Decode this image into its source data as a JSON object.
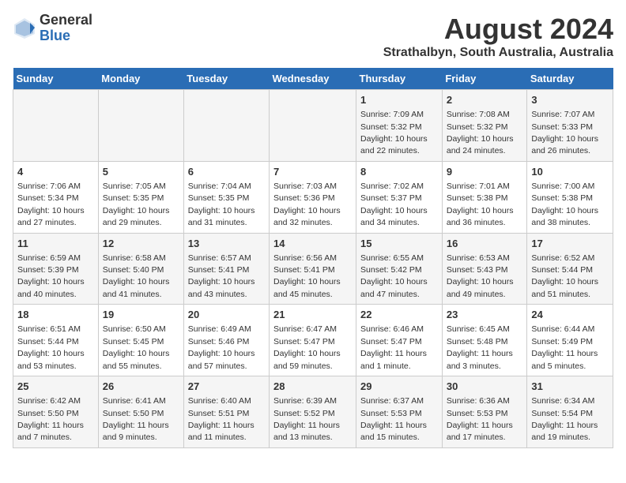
{
  "logo": {
    "general": "General",
    "blue": "Blue"
  },
  "title": {
    "month_year": "August 2024",
    "location": "Strathalbyn, South Australia, Australia"
  },
  "days_of_week": [
    "Sunday",
    "Monday",
    "Tuesday",
    "Wednesday",
    "Thursday",
    "Friday",
    "Saturday"
  ],
  "weeks": [
    [
      {
        "day": "",
        "info": ""
      },
      {
        "day": "",
        "info": ""
      },
      {
        "day": "",
        "info": ""
      },
      {
        "day": "",
        "info": ""
      },
      {
        "day": "1",
        "info": "Sunrise: 7:09 AM\nSunset: 5:32 PM\nDaylight: 10 hours\nand 22 minutes."
      },
      {
        "day": "2",
        "info": "Sunrise: 7:08 AM\nSunset: 5:32 PM\nDaylight: 10 hours\nand 24 minutes."
      },
      {
        "day": "3",
        "info": "Sunrise: 7:07 AM\nSunset: 5:33 PM\nDaylight: 10 hours\nand 26 minutes."
      }
    ],
    [
      {
        "day": "4",
        "info": "Sunrise: 7:06 AM\nSunset: 5:34 PM\nDaylight: 10 hours\nand 27 minutes."
      },
      {
        "day": "5",
        "info": "Sunrise: 7:05 AM\nSunset: 5:35 PM\nDaylight: 10 hours\nand 29 minutes."
      },
      {
        "day": "6",
        "info": "Sunrise: 7:04 AM\nSunset: 5:35 PM\nDaylight: 10 hours\nand 31 minutes."
      },
      {
        "day": "7",
        "info": "Sunrise: 7:03 AM\nSunset: 5:36 PM\nDaylight: 10 hours\nand 32 minutes."
      },
      {
        "day": "8",
        "info": "Sunrise: 7:02 AM\nSunset: 5:37 PM\nDaylight: 10 hours\nand 34 minutes."
      },
      {
        "day": "9",
        "info": "Sunrise: 7:01 AM\nSunset: 5:38 PM\nDaylight: 10 hours\nand 36 minutes."
      },
      {
        "day": "10",
        "info": "Sunrise: 7:00 AM\nSunset: 5:38 PM\nDaylight: 10 hours\nand 38 minutes."
      }
    ],
    [
      {
        "day": "11",
        "info": "Sunrise: 6:59 AM\nSunset: 5:39 PM\nDaylight: 10 hours\nand 40 minutes."
      },
      {
        "day": "12",
        "info": "Sunrise: 6:58 AM\nSunset: 5:40 PM\nDaylight: 10 hours\nand 41 minutes."
      },
      {
        "day": "13",
        "info": "Sunrise: 6:57 AM\nSunset: 5:41 PM\nDaylight: 10 hours\nand 43 minutes."
      },
      {
        "day": "14",
        "info": "Sunrise: 6:56 AM\nSunset: 5:41 PM\nDaylight: 10 hours\nand 45 minutes."
      },
      {
        "day": "15",
        "info": "Sunrise: 6:55 AM\nSunset: 5:42 PM\nDaylight: 10 hours\nand 47 minutes."
      },
      {
        "day": "16",
        "info": "Sunrise: 6:53 AM\nSunset: 5:43 PM\nDaylight: 10 hours\nand 49 minutes."
      },
      {
        "day": "17",
        "info": "Sunrise: 6:52 AM\nSunset: 5:44 PM\nDaylight: 10 hours\nand 51 minutes."
      }
    ],
    [
      {
        "day": "18",
        "info": "Sunrise: 6:51 AM\nSunset: 5:44 PM\nDaylight: 10 hours\nand 53 minutes."
      },
      {
        "day": "19",
        "info": "Sunrise: 6:50 AM\nSunset: 5:45 PM\nDaylight: 10 hours\nand 55 minutes."
      },
      {
        "day": "20",
        "info": "Sunrise: 6:49 AM\nSunset: 5:46 PM\nDaylight: 10 hours\nand 57 minutes."
      },
      {
        "day": "21",
        "info": "Sunrise: 6:47 AM\nSunset: 5:47 PM\nDaylight: 10 hours\nand 59 minutes."
      },
      {
        "day": "22",
        "info": "Sunrise: 6:46 AM\nSunset: 5:47 PM\nDaylight: 11 hours\nand 1 minute."
      },
      {
        "day": "23",
        "info": "Sunrise: 6:45 AM\nSunset: 5:48 PM\nDaylight: 11 hours\nand 3 minutes."
      },
      {
        "day": "24",
        "info": "Sunrise: 6:44 AM\nSunset: 5:49 PM\nDaylight: 11 hours\nand 5 minutes."
      }
    ],
    [
      {
        "day": "25",
        "info": "Sunrise: 6:42 AM\nSunset: 5:50 PM\nDaylight: 11 hours\nand 7 minutes."
      },
      {
        "day": "26",
        "info": "Sunrise: 6:41 AM\nSunset: 5:50 PM\nDaylight: 11 hours\nand 9 minutes."
      },
      {
        "day": "27",
        "info": "Sunrise: 6:40 AM\nSunset: 5:51 PM\nDaylight: 11 hours\nand 11 minutes."
      },
      {
        "day": "28",
        "info": "Sunrise: 6:39 AM\nSunset: 5:52 PM\nDaylight: 11 hours\nand 13 minutes."
      },
      {
        "day": "29",
        "info": "Sunrise: 6:37 AM\nSunset: 5:53 PM\nDaylight: 11 hours\nand 15 minutes."
      },
      {
        "day": "30",
        "info": "Sunrise: 6:36 AM\nSunset: 5:53 PM\nDaylight: 11 hours\nand 17 minutes."
      },
      {
        "day": "31",
        "info": "Sunrise: 6:34 AM\nSunset: 5:54 PM\nDaylight: 11 hours\nand 19 minutes."
      }
    ]
  ]
}
